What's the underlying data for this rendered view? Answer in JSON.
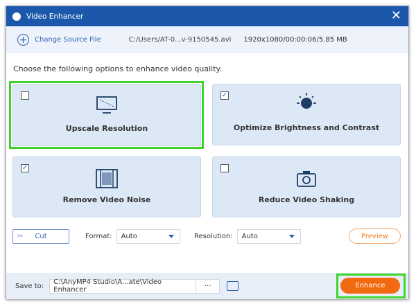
{
  "window": {
    "title": "Video Enhancer"
  },
  "source": {
    "change_label": "Change Source File",
    "path": "C:/Users/AT-0...v-9150545.avi",
    "meta": "1920x1080/00:00:06/5.85 MB"
  },
  "prompt": "Choose the following options to enhance video quality.",
  "options": [
    {
      "label": "Upscale Resolution",
      "checked": false
    },
    {
      "label": "Optimize Brightness and Contrast",
      "checked": true
    },
    {
      "label": "Remove Video Noise",
      "checked": true
    },
    {
      "label": "Reduce Video Shaking",
      "checked": false
    }
  ],
  "controls": {
    "cut_label": "Cut",
    "format_label": "Format:",
    "format_value": "Auto",
    "resolution_label": "Resolution:",
    "resolution_value": "Auto",
    "preview_label": "Preview"
  },
  "footer": {
    "save_label": "Save to:",
    "save_path": "C:\\AnyMP4 Studio\\A...ate\\Video Enhancer",
    "browse_label": "···",
    "enhance_label": "Enhance"
  },
  "colors": {
    "titlebar": "#1b58ab",
    "accent": "#f26a10",
    "highlight": "#3fd42b"
  }
}
